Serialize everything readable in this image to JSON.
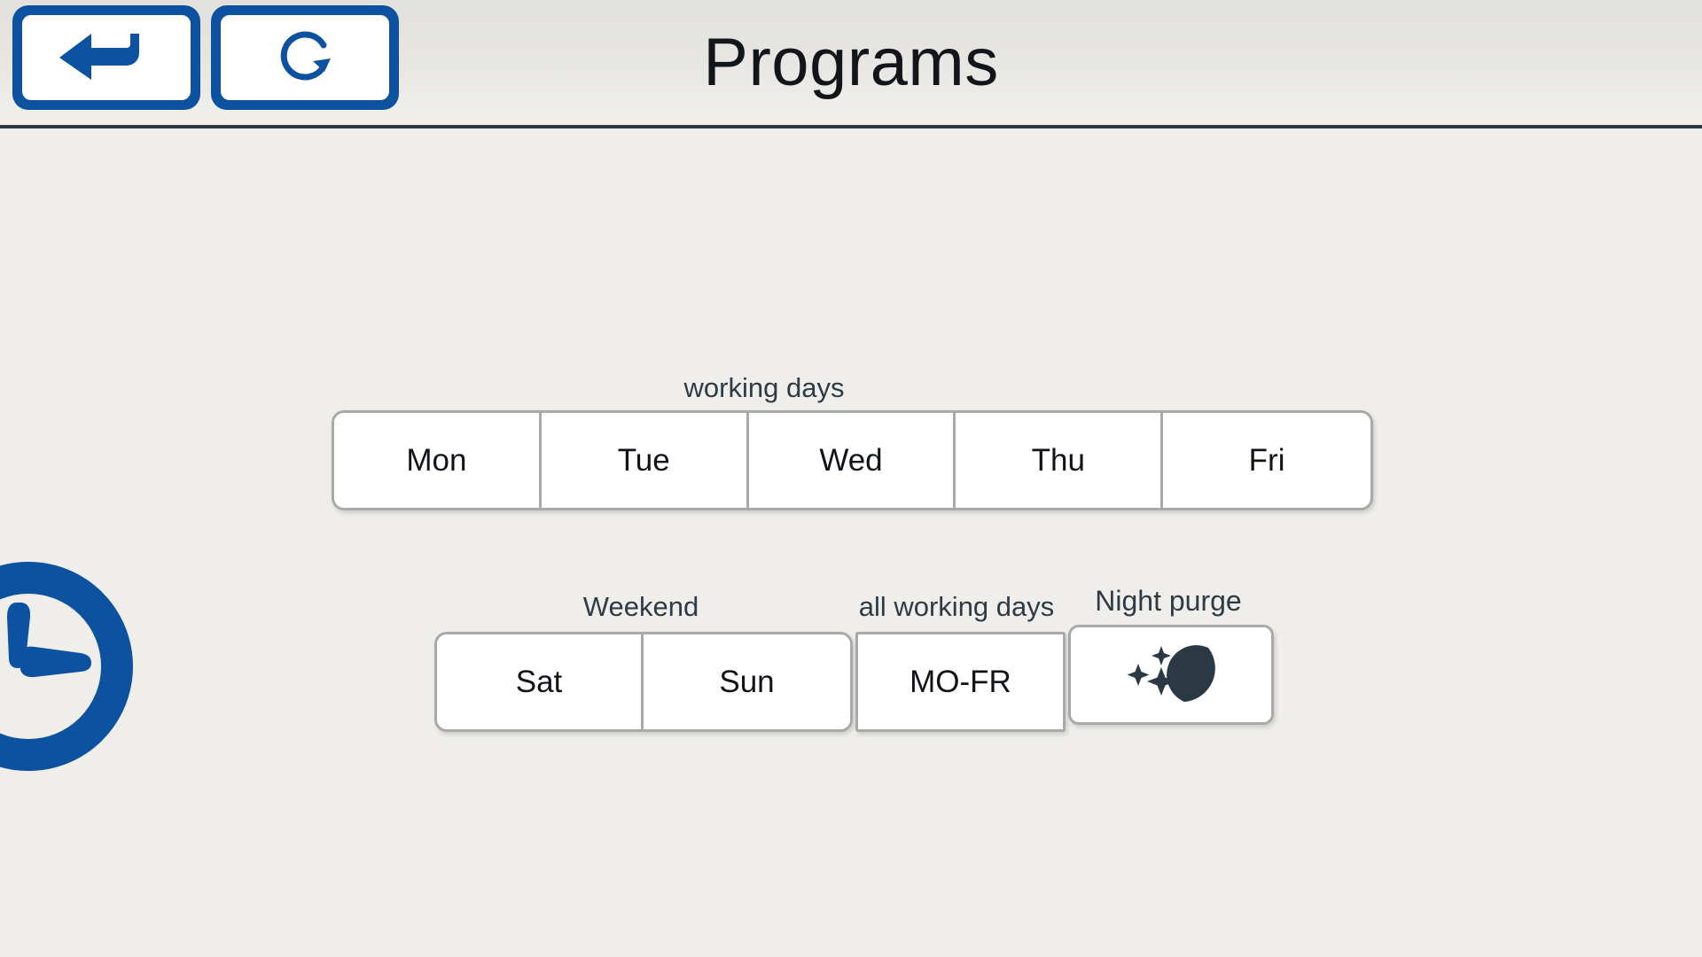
{
  "header": {
    "title": "Programs",
    "buttons": [
      {
        "name": "back-button",
        "icon": "back-arrow-icon"
      },
      {
        "name": "refresh-button",
        "icon": "refresh-icon"
      }
    ]
  },
  "main": {
    "sections": [
      {
        "label": "working days",
        "group": "workdays",
        "buttons": [
          {
            "label": "Mon"
          },
          {
            "label": "Tue"
          },
          {
            "label": "Wed"
          },
          {
            "label": "Thu"
          },
          {
            "label": "Fri"
          }
        ]
      },
      {
        "label": "Weekend",
        "group": "weekend",
        "buttons": [
          {
            "label": "Sat"
          },
          {
            "label": "Sun"
          }
        ]
      },
      {
        "label": "all working days",
        "group": "mofr",
        "buttons": [
          {
            "label": "MO-FR"
          }
        ]
      },
      {
        "label": "Night purge",
        "group": "nightpurge",
        "buttons": [
          {
            "label": "",
            "icon": "moon-stars-icon"
          }
        ]
      }
    ]
  },
  "decoration": {
    "clock_icon": "clock-icon"
  },
  "colors": {
    "accent_blue": "#0d52a0",
    "page_background": "#efeeea",
    "header_background": "#e4e3df",
    "header_rule": "#2c3742",
    "button_face": "#ffffff",
    "button_border": "#a9a9a7",
    "label_text": "#2d3b45",
    "button_text": "#101418",
    "icon_dark": "#2a3944"
  }
}
